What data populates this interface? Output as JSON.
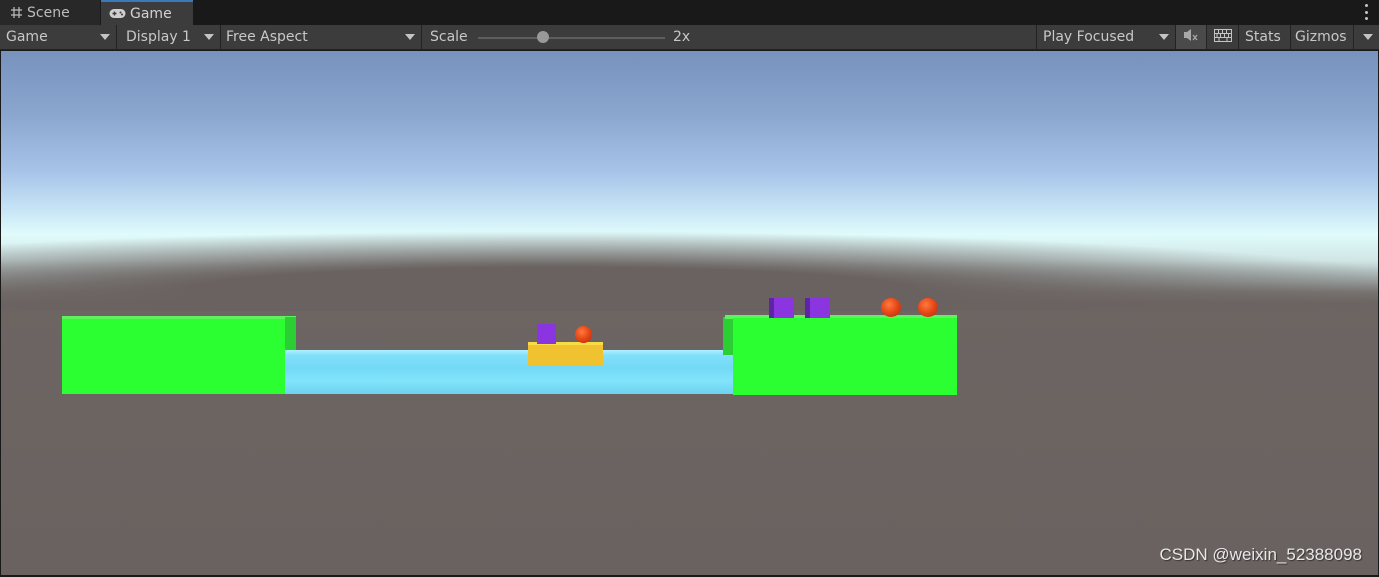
{
  "tabs": [
    {
      "label": "Scene",
      "icon": "grid-hash-icon",
      "active": false
    },
    {
      "label": "Game",
      "icon": "gamepad-icon",
      "active": true
    }
  ],
  "toolbar": {
    "mode_dropdown": "Game",
    "display_dropdown": "Display 1",
    "aspect_dropdown": "Free Aspect",
    "scale_label": "Scale",
    "scale_value": "2x",
    "scale_fraction": 0.35,
    "play_mode_dropdown": "Play Focused",
    "mute_icon": "mute-audio-icon",
    "keyboard_icon": "keyboard-icon",
    "stats_label": "Stats",
    "gizmos_label": "Gizmos"
  },
  "scene": {
    "colors": {
      "sky_top": "#7793bd",
      "horizon": "#e0fbfb",
      "ground": "#6a6260",
      "bank": "#2bff31",
      "water": "#7fdff9",
      "boat": "#f1c22f",
      "priest_cube": "#8a35e0",
      "devil_ball": "#e84a18"
    },
    "objects": {
      "left_bank": "Left bank",
      "right_bank": "Right bank",
      "river": "River",
      "boat": "Boat",
      "boat_passengers": [
        "cube",
        "ball"
      ],
      "right_bank_characters": [
        "cube",
        "cube",
        "ball",
        "ball"
      ]
    }
  },
  "watermark": "CSDN @weixin_52388098"
}
